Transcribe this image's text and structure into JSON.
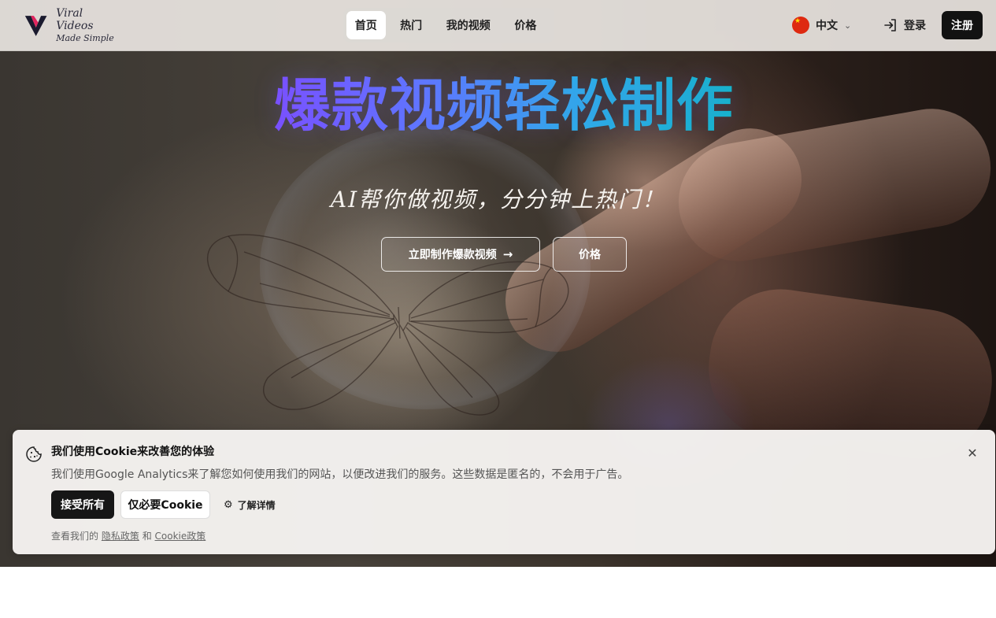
{
  "header": {
    "logo_line1": "Viral Videos",
    "logo_line2": "Made Simple",
    "nav": [
      {
        "label": "首页",
        "active": true
      },
      {
        "label": "热门",
        "active": false
      },
      {
        "label": "我的视频",
        "active": false
      },
      {
        "label": "价格",
        "active": false
      }
    ],
    "language": {
      "label": "中文",
      "flag_icon": "china-flag-icon",
      "chevron_icon": "chevron-down-icon"
    },
    "login_label": "登录",
    "signup_label": "注册"
  },
  "hero": {
    "title": "爆款视频轻松制作",
    "subtitle": "AI帮你做视频，分分钟上热门！",
    "primary_button": "立即制作爆款视频",
    "secondary_button": "价格",
    "title_gradient": [
      "#7b4dff",
      "#5b7cff",
      "#2bb0e8",
      "#10b8c8"
    ]
  },
  "cookie_banner": {
    "title": "我们使用Cookie来改善您的体验",
    "description": "我们使用Google Analytics来了解您如何使用我们的网站，以便改进我们的服务。这些数据是匿名的，不会用于广告。",
    "accept_all": "接受所有",
    "necessary_only": "仅必要Cookie",
    "learn_more": "了解详情",
    "footer_prefix": "查看我们的",
    "privacy_link": "隐私政策",
    "and": "和",
    "cookie_link": "Cookie政策"
  },
  "colors": {
    "primary_dark": "#121212",
    "header_bg": "#eeeae5",
    "banner_bg": "#f5f3f1"
  }
}
